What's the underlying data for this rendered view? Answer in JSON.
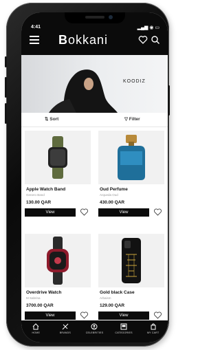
{
  "status": {
    "time": "4:41",
    "indicators": "▂▄▆ ◉ ▭"
  },
  "header": {
    "logo_initial": "B",
    "logo_rest": "okkani"
  },
  "banner": {
    "brand": "KOODIZ"
  },
  "sortbar": {
    "sort_label": "⇅  Sort",
    "filter_label": "▽  Filter"
  },
  "products": [
    {
      "name": "Apple Watch Band",
      "brand": "Genero Band",
      "price": "130.00 QAR",
      "view_label": "View"
    },
    {
      "name": "Oud Perfume",
      "brand": "Arqueda Oud",
      "price": "430.00 QAR",
      "view_label": "View"
    },
    {
      "name": "Overdrive Watch",
      "brand": "M Sabrina",
      "price": "3700.00 QAR",
      "view_label": "View"
    },
    {
      "name": "Gold black Case",
      "brand": "Arbaism",
      "price": "129.00 QAR",
      "view_label": "View"
    }
  ],
  "tabs": [
    {
      "label": "HOME",
      "icon": "home-icon"
    },
    {
      "label": "BRANDS",
      "icon": "brands-icon"
    },
    {
      "label": "CELEBRITIES",
      "icon": "celebrities-icon"
    },
    {
      "label": "CATEGORIES",
      "icon": "categories-icon"
    },
    {
      "label": "MY CART",
      "icon": "cart-icon"
    }
  ],
  "colors": {
    "bar": "#0b0b0b",
    "card_bg": "#f1f1f1",
    "text": "#111111"
  }
}
